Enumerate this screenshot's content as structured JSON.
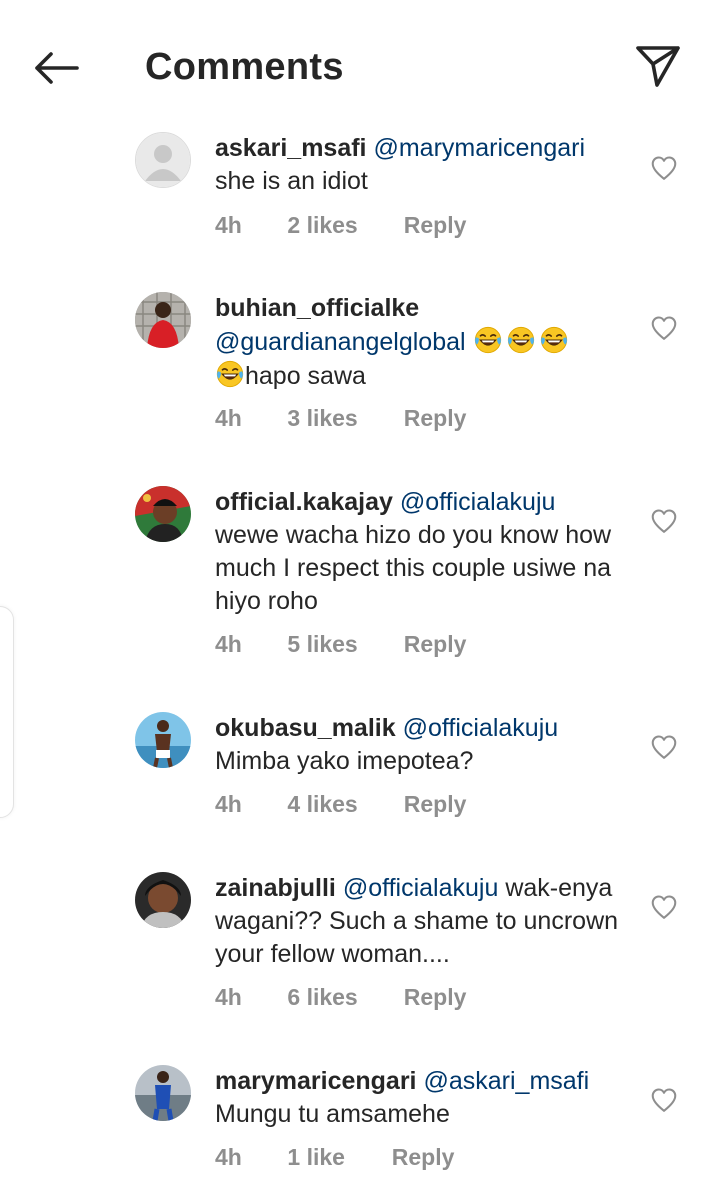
{
  "header": {
    "title": "Comments"
  },
  "icons": {
    "back": "back-arrow-icon",
    "share": "send-icon",
    "like": "heart-outline-icon",
    "emoji": "face-with-tears-of-joy-emoji"
  },
  "colors": {
    "text": "#262626",
    "mention": "#00376b",
    "meta": "#8e8e8e"
  },
  "comments": [
    {
      "username": "askari_msafi",
      "mention": "@marymaricengari",
      "text": "she is an idiot",
      "time": "4h",
      "likes": "2 likes",
      "reply": "Reply"
    },
    {
      "username": "buhian_officialke",
      "mention": "@guardianangelglobal",
      "text": "hapo sawa",
      "time": "4h",
      "likes": "3 likes",
      "reply": "Reply"
    },
    {
      "username": "official.kakajay",
      "mention": "@officialakuju",
      "text": "wewe wacha hizo do you  know how much I respect this couple usiwe na hiyo roho",
      "time": "4h",
      "likes": "5 likes",
      "reply": "Reply"
    },
    {
      "username": "okubasu_malik",
      "mention": "@officialakuju",
      "text": "Mimba yako imepotea?",
      "time": "4h",
      "likes": "4 likes",
      "reply": "Reply"
    },
    {
      "username": "zainabjulli",
      "mention": "@officialakuju",
      "text": "wak-enya wagani?? Such a shame to uncrown your fellow woman....",
      "time": "4h",
      "likes": "6 likes",
      "reply": "Reply"
    },
    {
      "username": "marymaricengari",
      "mention": "@askari_msafi",
      "text": "Mungu tu amsamehe",
      "time": "4h",
      "likes": "1 like",
      "reply": "Reply"
    }
  ]
}
